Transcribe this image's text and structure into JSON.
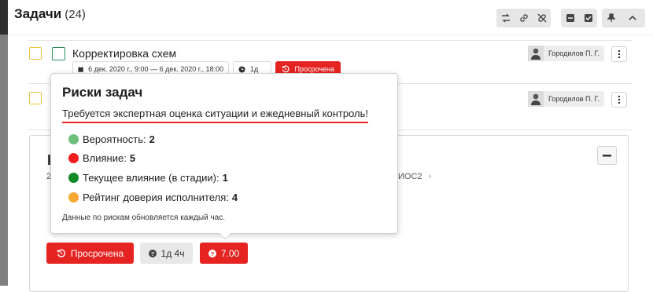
{
  "header": {
    "title": "Задачи",
    "count": "(24)",
    "toolbar": {
      "group1": [
        "swap-icon",
        "link-icon",
        "unlink-icon"
      ],
      "group2": [
        "collapse-all-icon",
        "check-all-icon"
      ],
      "group3": [
        "pin-icon",
        "chevron-up-icon"
      ]
    }
  },
  "tasks": [
    {
      "name": "Корректировка схем",
      "date_range": "6 дек. 2020 г., 9:00 — 6 дек. 2020 г., 18:00",
      "duration": "1д",
      "status": "Просрочена",
      "assignee": "Городилов П. Г."
    },
    {
      "assignee": "Городилов П. Г."
    }
  ],
  "panel": {
    "fragment_code": "ИОС2",
    "fragment_digit": "2",
    "status_button": "Просрочена",
    "duration_button": "1д 4ч",
    "risk_button": "7.00"
  },
  "popover": {
    "title": "Риски задач",
    "subtitle": "Требуется экспертная оценка ситуации и ежедневный контроль!",
    "items": [
      {
        "label": "Вероятность:",
        "value": "2",
        "color": "#6cc07a"
      },
      {
        "label": "Влияние:",
        "value": "5",
        "color": "#f21d1d"
      },
      {
        "label": "Текущее влияние (в стадии):",
        "value": "1",
        "color": "#118a28"
      },
      {
        "label": "Рейтинг доверия исполнителя:",
        "value": "4",
        "color": "#f7a833"
      }
    ],
    "note": "Данные по рискам обновляется каждый час."
  },
  "colors": {
    "danger": "#e52321",
    "checkbox_yellow": "#f0c23e",
    "checkbox_green": "#2e8b57"
  }
}
